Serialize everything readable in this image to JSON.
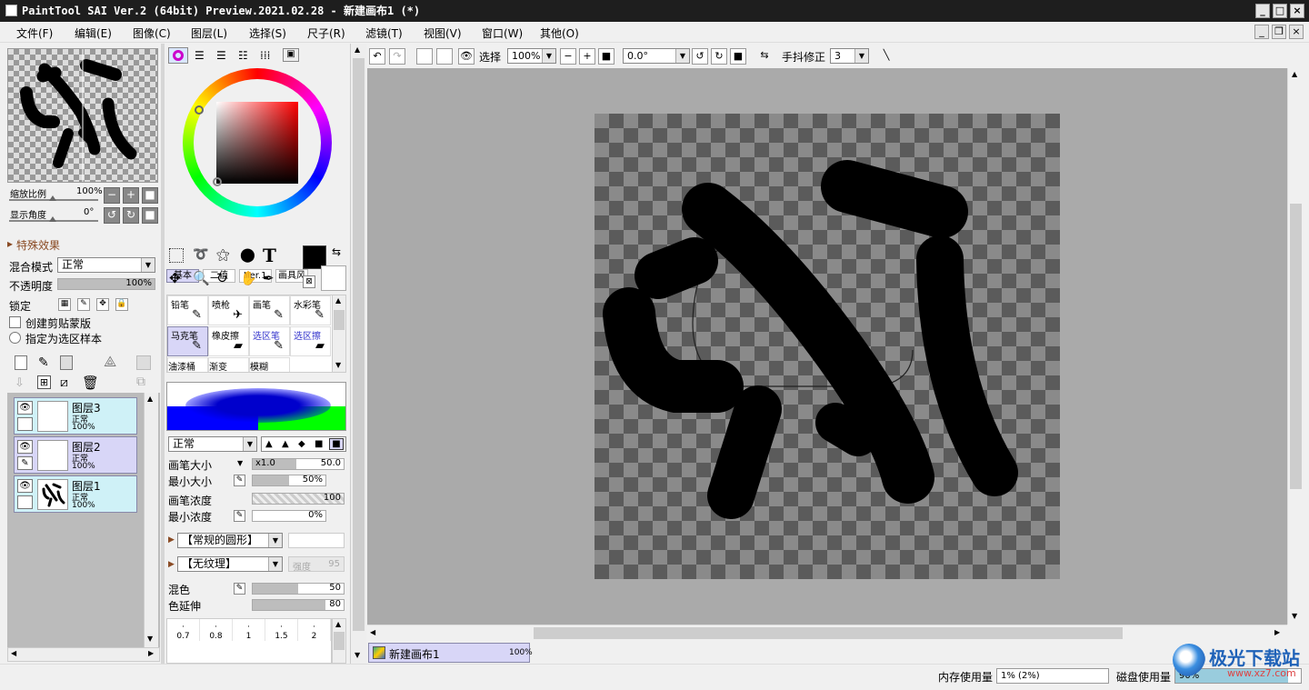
{
  "window": {
    "title": "PaintTool SAI Ver.2 (64bit) Preview.2021.02.28 - 新建画布1 (*)",
    "controls": [
      "_",
      "□",
      "×"
    ]
  },
  "menu": [
    "文件(F)",
    "编辑(E)",
    "图像(C)",
    "图层(L)",
    "选择(S)",
    "尺子(R)",
    "滤镜(T)",
    "视图(V)",
    "窗口(W)",
    "其他(O)"
  ],
  "navigator": {
    "zoom_label": "缩放比例",
    "zoom_value": "100%",
    "angle_label": "显示角度",
    "angle_value": "0°"
  },
  "layer_panel": {
    "effects_title": "特殊效果",
    "blend_label": "混合模式",
    "blend_value": "正常",
    "opacity_label": "不透明度",
    "opacity_value": "100%",
    "opacity_level": 1.0,
    "lock_label": "锁定",
    "clip_label": "创建剪贴蒙版",
    "selection_label": "指定为选区样本",
    "layers": [
      {
        "name": "图层3",
        "mode": "正常",
        "opacity": "100%",
        "selected": false
      },
      {
        "name": "图层2",
        "mode": "正常",
        "opacity": "100%",
        "selected": true
      },
      {
        "name": "图层1",
        "mode": "正常",
        "opacity": "100%",
        "selected": false
      }
    ]
  },
  "color_panel": {
    "tabs": [
      "基本",
      "二值",
      "Ver.1",
      "画具风"
    ],
    "primary_color": "#000000",
    "secondary_color": "#ffffff"
  },
  "tools": [
    {
      "name": "铅笔",
      "icon": "✎"
    },
    {
      "name": "喷枪",
      "icon": "✈"
    },
    {
      "name": "画笔",
      "icon": "🖌"
    },
    {
      "name": "水彩笔",
      "icon": "🖌"
    },
    {
      "name": "马克笔",
      "icon": "✎"
    },
    {
      "name": "橡皮擦",
      "icon": "▰"
    },
    {
      "name": "选区笔",
      "icon": "✎"
    },
    {
      "name": "选区擦",
      "icon": "▰"
    },
    {
      "name": "油漆桶",
      "icon": ""
    },
    {
      "name": "渐变",
      "icon": ""
    },
    {
      "name": "模糊",
      "icon": ""
    }
  ],
  "brush": {
    "mode": "正常",
    "size_label": "画笔大小",
    "size_mult": "x1.0",
    "size_value": "50.0",
    "min_size_label": "最小大小",
    "min_size_value": "50%",
    "density_label": "画笔浓度",
    "density_value": "100",
    "min_density_label": "最小浓度",
    "min_density_value": "0%",
    "shape": "【常规的圆形】",
    "texture": "【无纹理】",
    "texture_strength_label": "强度",
    "texture_strength": "95",
    "blend_label": "混色",
    "blend_value": "50",
    "persist_label": "色延伸",
    "persist_value": "80",
    "size_presets": [
      "0.7",
      "0.8",
      "1",
      "1.5",
      "2"
    ]
  },
  "canvas_toolbar": {
    "select_label": "选择",
    "zoom": "100%",
    "angle": "0.0°",
    "stabilizer_label": "手抖修正",
    "stabilizer_value": "3"
  },
  "canvas_tab": {
    "name": "新建画布1",
    "zoom": "100%"
  },
  "status": {
    "memory_label": "内存使用量",
    "memory_value": "1% (2%)",
    "disk_label": "磁盘使用量",
    "disk_value": "90%"
  },
  "watermark": {
    "text": "极光下载站",
    "url": "www.xz7.com"
  }
}
